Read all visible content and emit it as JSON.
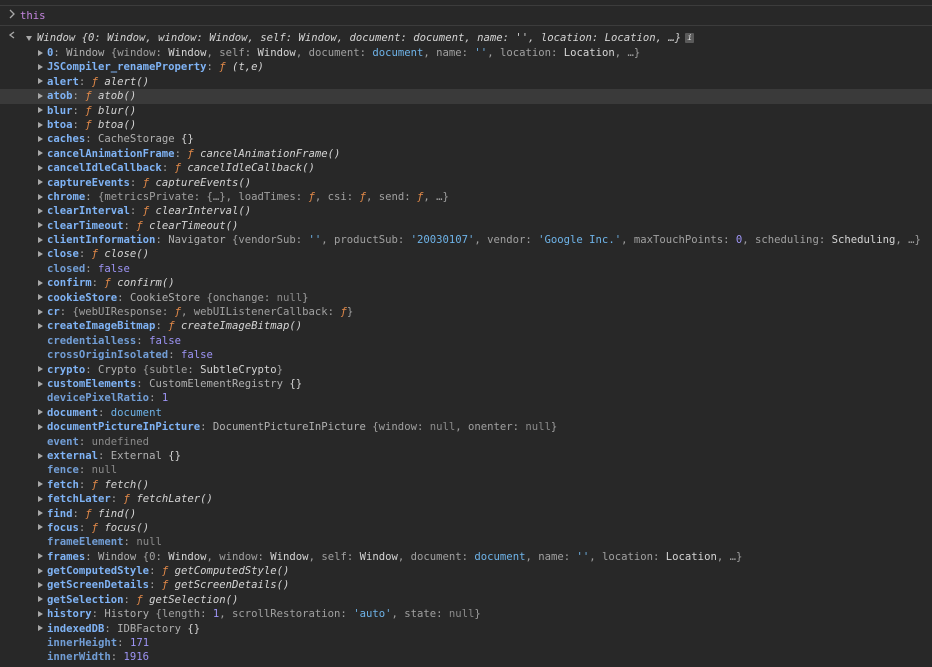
{
  "console": {
    "input": "this",
    "summary": "Window {0: Window, window: Window, self: Window, document: document, name: '', location: Location, …}",
    "info_badge": "i",
    "properties": [
      {
        "key": "0",
        "expandable": true,
        "segments": [
          {
            "t": "Window",
            "c": "cls"
          },
          {
            "t": " {window: ",
            "c": "p"
          },
          {
            "t": "Window",
            "c": "plain"
          },
          {
            "t": ", self: ",
            "c": "p"
          },
          {
            "t": "Window",
            "c": "plain"
          },
          {
            "t": ", document: ",
            "c": "p"
          },
          {
            "t": "document",
            "c": "str"
          },
          {
            "t": ", name: ",
            "c": "p"
          },
          {
            "t": "''",
            "c": "str"
          },
          {
            "t": ", location: ",
            "c": "p"
          },
          {
            "t": "Location",
            "c": "plain"
          },
          {
            "t": ", …}",
            "c": "p"
          }
        ]
      },
      {
        "key": "JSCompiler_renameProperty",
        "expandable": true,
        "segments": [
          {
            "t": "ƒ ",
            "c": "f"
          },
          {
            "t": "(t,e)",
            "c": "fn"
          }
        ]
      },
      {
        "key": "alert",
        "expandable": true,
        "segments": [
          {
            "t": "ƒ ",
            "c": "f"
          },
          {
            "t": "alert()",
            "c": "fn"
          }
        ]
      },
      {
        "key": "atob",
        "expandable": true,
        "hover": true,
        "segments": [
          {
            "t": "ƒ ",
            "c": "f"
          },
          {
            "t": "atob()",
            "c": "fn"
          }
        ]
      },
      {
        "key": "blur",
        "expandable": true,
        "segments": [
          {
            "t": "ƒ ",
            "c": "f"
          },
          {
            "t": "blur()",
            "c": "fn"
          }
        ]
      },
      {
        "key": "btoa",
        "expandable": true,
        "segments": [
          {
            "t": "ƒ ",
            "c": "f"
          },
          {
            "t": "btoa()",
            "c": "fn"
          }
        ]
      },
      {
        "key": "caches",
        "expandable": true,
        "segments": [
          {
            "t": "CacheStorage",
            "c": "cls"
          },
          {
            "t": " {}",
            "c": "plain"
          }
        ]
      },
      {
        "key": "cancelAnimationFrame",
        "expandable": true,
        "segments": [
          {
            "t": "ƒ ",
            "c": "f"
          },
          {
            "t": "cancelAnimationFrame()",
            "c": "fn"
          }
        ]
      },
      {
        "key": "cancelIdleCallback",
        "expandable": true,
        "segments": [
          {
            "t": "ƒ ",
            "c": "f"
          },
          {
            "t": "cancelIdleCallback()",
            "c": "fn"
          }
        ]
      },
      {
        "key": "captureEvents",
        "expandable": true,
        "segments": [
          {
            "t": "ƒ ",
            "c": "f"
          },
          {
            "t": "captureEvents()",
            "c": "fn"
          }
        ]
      },
      {
        "key": "chrome",
        "expandable": true,
        "segments": [
          {
            "t": "{metricsPrivate: {…}, loadTimes: ",
            "c": "p"
          },
          {
            "t": "ƒ",
            "c": "f"
          },
          {
            "t": ", csi: ",
            "c": "p"
          },
          {
            "t": "ƒ",
            "c": "f"
          },
          {
            "t": ", send: ",
            "c": "p"
          },
          {
            "t": "ƒ",
            "c": "f"
          },
          {
            "t": ", …}",
            "c": "p"
          }
        ]
      },
      {
        "key": "clearInterval",
        "expandable": true,
        "segments": [
          {
            "t": "ƒ ",
            "c": "f"
          },
          {
            "t": "clearInterval()",
            "c": "fn"
          }
        ]
      },
      {
        "key": "clearTimeout",
        "expandable": true,
        "segments": [
          {
            "t": "ƒ ",
            "c": "f"
          },
          {
            "t": "clearTimeout()",
            "c": "fn"
          }
        ]
      },
      {
        "key": "clientInformation",
        "expandable": true,
        "segments": [
          {
            "t": "Navigator",
            "c": "cls"
          },
          {
            "t": " {vendorSub: ",
            "c": "p"
          },
          {
            "t": "''",
            "c": "str"
          },
          {
            "t": ", productSub: ",
            "c": "p"
          },
          {
            "t": "'20030107'",
            "c": "str"
          },
          {
            "t": ", vendor: ",
            "c": "p"
          },
          {
            "t": "'Google Inc.'",
            "c": "str"
          },
          {
            "t": ", maxTouchPoints: ",
            "c": "p"
          },
          {
            "t": "0",
            "c": "num"
          },
          {
            "t": ", scheduling: ",
            "c": "p"
          },
          {
            "t": "Scheduling",
            "c": "plain"
          },
          {
            "t": ", …}",
            "c": "p"
          }
        ]
      },
      {
        "key": "close",
        "expandable": true,
        "segments": [
          {
            "t": "ƒ ",
            "c": "f"
          },
          {
            "t": "close()",
            "c": "fn"
          }
        ]
      },
      {
        "key": "closed",
        "expandable": false,
        "segments": [
          {
            "t": "false",
            "c": "bool"
          }
        ]
      },
      {
        "key": "confirm",
        "expandable": true,
        "segments": [
          {
            "t": "ƒ ",
            "c": "f"
          },
          {
            "t": "confirm()",
            "c": "fn"
          }
        ]
      },
      {
        "key": "cookieStore",
        "expandable": true,
        "segments": [
          {
            "t": "CookieStore",
            "c": "cls"
          },
          {
            "t": " {onchange: ",
            "c": "p"
          },
          {
            "t": "null",
            "c": "nul"
          },
          {
            "t": "}",
            "c": "p"
          }
        ]
      },
      {
        "key": "cr",
        "expandable": true,
        "segments": [
          {
            "t": "{webUIResponse: ",
            "c": "p"
          },
          {
            "t": "ƒ",
            "c": "f"
          },
          {
            "t": ", webUIListenerCallback: ",
            "c": "p"
          },
          {
            "t": "ƒ",
            "c": "f"
          },
          {
            "t": "}",
            "c": "p"
          }
        ]
      },
      {
        "key": "createImageBitmap",
        "expandable": true,
        "segments": [
          {
            "t": "ƒ ",
            "c": "f"
          },
          {
            "t": "createImageBitmap()",
            "c": "fn"
          }
        ]
      },
      {
        "key": "credentialless",
        "expandable": false,
        "segments": [
          {
            "t": "false",
            "c": "bool"
          }
        ]
      },
      {
        "key": "crossOriginIsolated",
        "expandable": false,
        "segments": [
          {
            "t": "false",
            "c": "bool"
          }
        ]
      },
      {
        "key": "crypto",
        "expandable": true,
        "segments": [
          {
            "t": "Crypto",
            "c": "cls"
          },
          {
            "t": " {subtle: ",
            "c": "p"
          },
          {
            "t": "SubtleCrypto",
            "c": "plain"
          },
          {
            "t": "}",
            "c": "p"
          }
        ]
      },
      {
        "key": "customElements",
        "expandable": true,
        "segments": [
          {
            "t": "CustomElementRegistry",
            "c": "cls"
          },
          {
            "t": " {}",
            "c": "plain"
          }
        ]
      },
      {
        "key": "devicePixelRatio",
        "expandable": false,
        "segments": [
          {
            "t": "1",
            "c": "num"
          }
        ]
      },
      {
        "key": "document",
        "expandable": true,
        "segments": [
          {
            "t": "document",
            "c": "str"
          }
        ]
      },
      {
        "key": "documentPictureInPicture",
        "expandable": true,
        "segments": [
          {
            "t": "DocumentPictureInPicture",
            "c": "cls"
          },
          {
            "t": " {window: ",
            "c": "p"
          },
          {
            "t": "null",
            "c": "nul"
          },
          {
            "t": ", onenter: ",
            "c": "p"
          },
          {
            "t": "null",
            "c": "nul"
          },
          {
            "t": "}",
            "c": "p"
          }
        ]
      },
      {
        "key": "event",
        "expandable": false,
        "segments": [
          {
            "t": "undefined",
            "c": "nul"
          }
        ]
      },
      {
        "key": "external",
        "expandable": true,
        "segments": [
          {
            "t": "External",
            "c": "cls"
          },
          {
            "t": " {}",
            "c": "plain"
          }
        ]
      },
      {
        "key": "fence",
        "expandable": false,
        "segments": [
          {
            "t": "null",
            "c": "nul"
          }
        ]
      },
      {
        "key": "fetch",
        "expandable": true,
        "segments": [
          {
            "t": "ƒ ",
            "c": "f"
          },
          {
            "t": "fetch()",
            "c": "fn"
          }
        ]
      },
      {
        "key": "fetchLater",
        "expandable": true,
        "segments": [
          {
            "t": "ƒ ",
            "c": "f"
          },
          {
            "t": "fetchLater()",
            "c": "fn"
          }
        ]
      },
      {
        "key": "find",
        "expandable": true,
        "segments": [
          {
            "t": "ƒ ",
            "c": "f"
          },
          {
            "t": "find()",
            "c": "fn"
          }
        ]
      },
      {
        "key": "focus",
        "expandable": true,
        "segments": [
          {
            "t": "ƒ ",
            "c": "f"
          },
          {
            "t": "focus()",
            "c": "fn"
          }
        ]
      },
      {
        "key": "frameElement",
        "expandable": false,
        "segments": [
          {
            "t": "null",
            "c": "nul"
          }
        ]
      },
      {
        "key": "frames",
        "expandable": true,
        "segments": [
          {
            "t": "Window",
            "c": "cls"
          },
          {
            "t": " {0: ",
            "c": "p"
          },
          {
            "t": "Window",
            "c": "plain"
          },
          {
            "t": ", window: ",
            "c": "p"
          },
          {
            "t": "Window",
            "c": "plain"
          },
          {
            "t": ", self: ",
            "c": "p"
          },
          {
            "t": "Window",
            "c": "plain"
          },
          {
            "t": ", document: ",
            "c": "p"
          },
          {
            "t": "document",
            "c": "str"
          },
          {
            "t": ", name: ",
            "c": "p"
          },
          {
            "t": "''",
            "c": "str"
          },
          {
            "t": ", location: ",
            "c": "p"
          },
          {
            "t": "Location",
            "c": "plain"
          },
          {
            "t": ", …}",
            "c": "p"
          }
        ]
      },
      {
        "key": "getComputedStyle",
        "expandable": true,
        "segments": [
          {
            "t": "ƒ ",
            "c": "f"
          },
          {
            "t": "getComputedStyle()",
            "c": "fn"
          }
        ]
      },
      {
        "key": "getScreenDetails",
        "expandable": true,
        "segments": [
          {
            "t": "ƒ ",
            "c": "f"
          },
          {
            "t": "getScreenDetails()",
            "c": "fn"
          }
        ]
      },
      {
        "key": "getSelection",
        "expandable": true,
        "segments": [
          {
            "t": "ƒ ",
            "c": "f"
          },
          {
            "t": "getSelection()",
            "c": "fn"
          }
        ]
      },
      {
        "key": "history",
        "expandable": true,
        "segments": [
          {
            "t": "History",
            "c": "cls"
          },
          {
            "t": " {length: ",
            "c": "p"
          },
          {
            "t": "1",
            "c": "num"
          },
          {
            "t": ", scrollRestoration: ",
            "c": "p"
          },
          {
            "t": "'auto'",
            "c": "str"
          },
          {
            "t": ", state: ",
            "c": "p"
          },
          {
            "t": "null",
            "c": "nul"
          },
          {
            "t": "}",
            "c": "p"
          }
        ]
      },
      {
        "key": "indexedDB",
        "expandable": true,
        "segments": [
          {
            "t": "IDBFactory",
            "c": "cls"
          },
          {
            "t": " {}",
            "c": "plain"
          }
        ]
      },
      {
        "key": "innerHeight",
        "expandable": false,
        "segments": [
          {
            "t": "171",
            "c": "num"
          }
        ]
      },
      {
        "key": "innerWidth",
        "expandable": false,
        "segments": [
          {
            "t": "1916",
            "c": "num"
          }
        ]
      }
    ]
  },
  "icons": {
    "prompt": "chevron-right-icon",
    "result": "chevron-left-icon",
    "expand": "triangle-right-icon",
    "collapse": "triangle-down-icon",
    "info": "info-icon"
  },
  "colors": {
    "background": "#282828",
    "key": "#7fb3f5",
    "function_glyph": "#e38a49",
    "string": "#6eb3e8",
    "number": "#9d94f5",
    "null": "#8a8a8a",
    "input": "#c586e0",
    "hover_row": "#3a3a3a"
  }
}
